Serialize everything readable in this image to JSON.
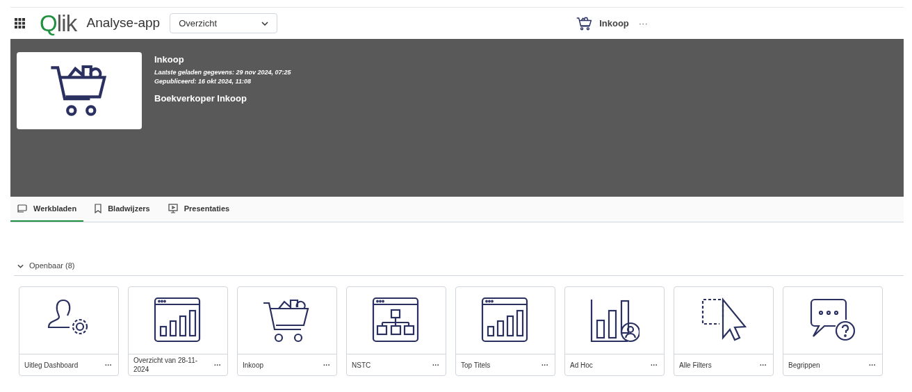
{
  "header": {
    "logo": "Qlik",
    "app_title": "Analyse-app",
    "view_select": "Overzicht",
    "app_name": "Inkoop",
    "more": "···"
  },
  "banner": {
    "title": "Inkoop",
    "last_loaded": "Laatste geladen gegevens: 29 nov 2024, 07:25",
    "published": "Gepubliceerd: 16 okt 2024, 11:08",
    "description": "Boekverkoper Inkoop"
  },
  "tabs": [
    {
      "label": "Werkbladen",
      "kind": "sheet",
      "selected": true
    },
    {
      "label": "Bladwijzers",
      "kind": "bookmark",
      "selected": false
    },
    {
      "label": "Presentaties",
      "kind": "presentation",
      "selected": false
    }
  ],
  "section": {
    "label": "Openbaar (8)",
    "expanded": true
  },
  "sheets": [
    {
      "title": "Uitleg Dashboard",
      "kind": "user-gear"
    },
    {
      "title": "Overzicht van 28-11-2024",
      "kind": "window-bars"
    },
    {
      "title": "Inkoop",
      "kind": "cart"
    },
    {
      "title": "NSTC",
      "kind": "window-tree"
    },
    {
      "title": "Top Titels",
      "kind": "window-bars"
    },
    {
      "title": "Ad Hoc",
      "kind": "bars-user"
    },
    {
      "title": "Alle Filters",
      "kind": "select-cursor"
    },
    {
      "title": "Begrippen",
      "kind": "chat-question"
    }
  ]
}
